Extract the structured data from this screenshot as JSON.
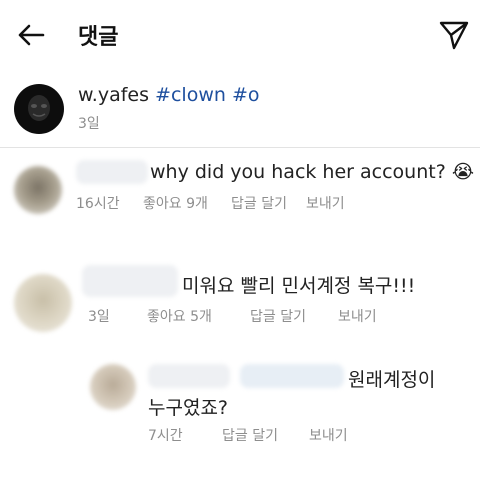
{
  "header": {
    "title": "댓글"
  },
  "post": {
    "username": "w.yafes",
    "hashtags": [
      "#clown",
      "#o"
    ],
    "time": "3일"
  },
  "comments": [
    {
      "text": "why did you hack her account? 😭",
      "time": "16시간",
      "likes": "좋아요 9개",
      "reply": "답글 달기",
      "send": "보내기"
    },
    {
      "text": "미워요 빨리 민서계정 복구!!!",
      "time": "3일",
      "likes": "좋아요 5개",
      "reply": "답글 달기",
      "send": "보내기"
    }
  ],
  "reply": {
    "text_line1": "원래계정이",
    "text_line2": "누구였죠?",
    "time": "7시간",
    "reply": "답글 달기",
    "send": "보내기"
  }
}
